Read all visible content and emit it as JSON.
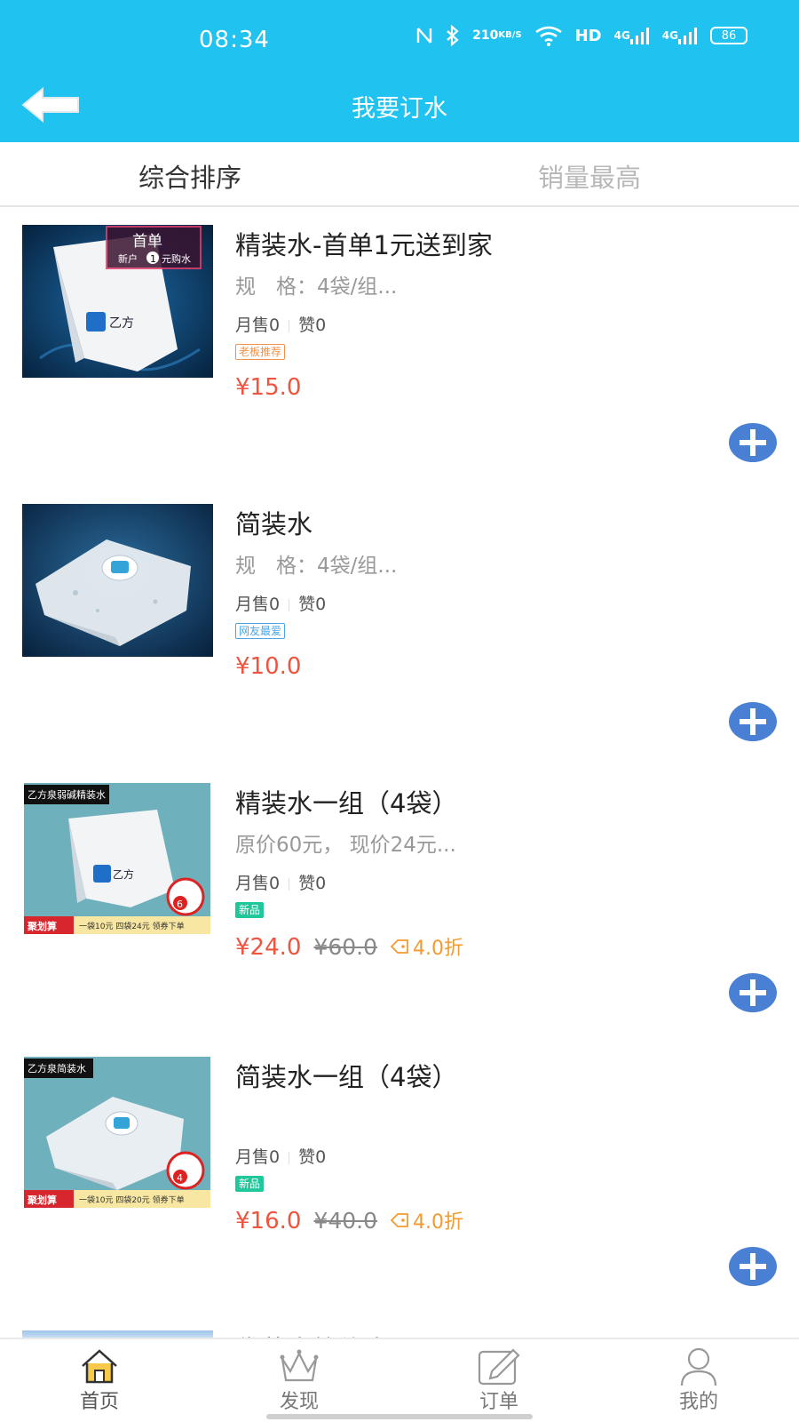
{
  "status_bar": {
    "time": "08:34",
    "speed_top": "210",
    "speed_bottom": "KB/S",
    "hd": "HD",
    "sig1": "4G",
    "sig2": "4G",
    "battery": "86"
  },
  "header": {
    "title": "我要订水"
  },
  "sort_tabs": [
    {
      "label": "综合排序",
      "active": true
    },
    {
      "label": "销量最高",
      "active": false
    }
  ],
  "products": [
    {
      "name": "精装水-首单1元送到家",
      "spec": "规　格：4袋/组...",
      "monthly_sales": "月售0",
      "likes": "赞0",
      "tag": "老板推荐",
      "price": "¥15.0",
      "image_text": {
        "banner_title": "首单",
        "banner_sub": "新户",
        "banner_num": "1",
        "banner_end": "元购水"
      }
    },
    {
      "name": "简装水",
      "spec": "规　格：4袋/组...",
      "monthly_sales": "月售0",
      "likes": "赞0",
      "tag": "网友最爱",
      "price": "¥10.0"
    },
    {
      "name": "精装水一组（4袋）",
      "spec": "原价60元， 现价24元...",
      "monthly_sales": "月售0",
      "likes": "赞0",
      "tag": "新品",
      "price": "¥24.0",
      "old_price": "¥60.0",
      "discount": "4.0折",
      "image_text": {
        "top_label": "乙方泉弱碱精装水",
        "badge_num": "6",
        "bottom_brand": "聚划算",
        "bottom_text": "一袋10元 四袋24元 领券下单"
      }
    },
    {
      "name": "简装水一组（4袋）",
      "spec": "",
      "monthly_sales": "月售0",
      "likes": "赞0",
      "tag": "新品",
      "price": "¥16.0",
      "old_price": "¥40.0",
      "discount": "4.0折",
      "image_text": {
        "top_label": "乙方泉简装水",
        "badge_num": "4",
        "bottom_brand": "聚划算",
        "bottom_text": "一袋10元 四袋20元 领券下单"
      }
    }
  ],
  "partial_product": {
    "name": "袋装水简约水理"
  },
  "bottom_nav": [
    {
      "label": "首页",
      "icon": "home-icon"
    },
    {
      "label": "发现",
      "icon": "crown-icon"
    },
    {
      "label": "订单",
      "icon": "edit-icon"
    },
    {
      "label": "我的",
      "icon": "user-icon"
    }
  ],
  "colors": {
    "header_bg": "#20c3ef",
    "price": "#f0543f",
    "add_button": "#4a80d3",
    "discount": "#f39a31"
  }
}
